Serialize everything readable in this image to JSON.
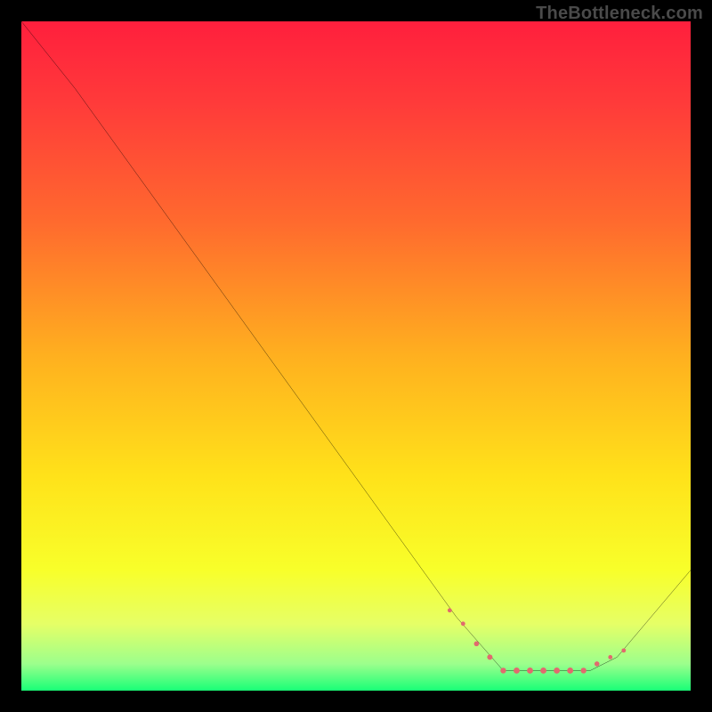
{
  "watermark": "TheBottleneck.com",
  "chart_data": {
    "type": "line",
    "title": "",
    "xlabel": "",
    "ylabel": "",
    "xlim": [
      0,
      100
    ],
    "ylim": [
      0,
      100
    ],
    "grid": false,
    "legend": false,
    "series": [
      {
        "name": "curve",
        "x": [
          0,
          8,
          65,
          72,
          85,
          89,
          100
        ],
        "values": [
          100,
          90,
          11,
          3,
          3,
          5,
          18
        ]
      }
    ],
    "markers": {
      "name": "highlight-dots",
      "color": "#e16a6e",
      "x": [
        64,
        66,
        68,
        70,
        72,
        74,
        76,
        78,
        80,
        82,
        84,
        86,
        88,
        90
      ],
      "values": [
        12,
        10,
        7,
        5,
        3,
        3,
        3,
        3,
        3,
        3,
        3,
        4,
        5,
        6
      ],
      "r": [
        2.4,
        2.4,
        2.8,
        3.0,
        3.2,
        3.4,
        3.4,
        3.4,
        3.4,
        3.4,
        3.2,
        2.8,
        2.4,
        2.4
      ]
    },
    "gradient_stops": [
      {
        "offset": 0.0,
        "color": "#ff1f3d"
      },
      {
        "offset": 0.12,
        "color": "#ff3a3a"
      },
      {
        "offset": 0.3,
        "color": "#ff6a2e"
      },
      {
        "offset": 0.5,
        "color": "#ffb01f"
      },
      {
        "offset": 0.68,
        "color": "#ffe21a"
      },
      {
        "offset": 0.82,
        "color": "#f8ff2a"
      },
      {
        "offset": 0.9,
        "color": "#e6ff66"
      },
      {
        "offset": 0.96,
        "color": "#9cff8c"
      },
      {
        "offset": 1.0,
        "color": "#19ff77"
      }
    ]
  }
}
